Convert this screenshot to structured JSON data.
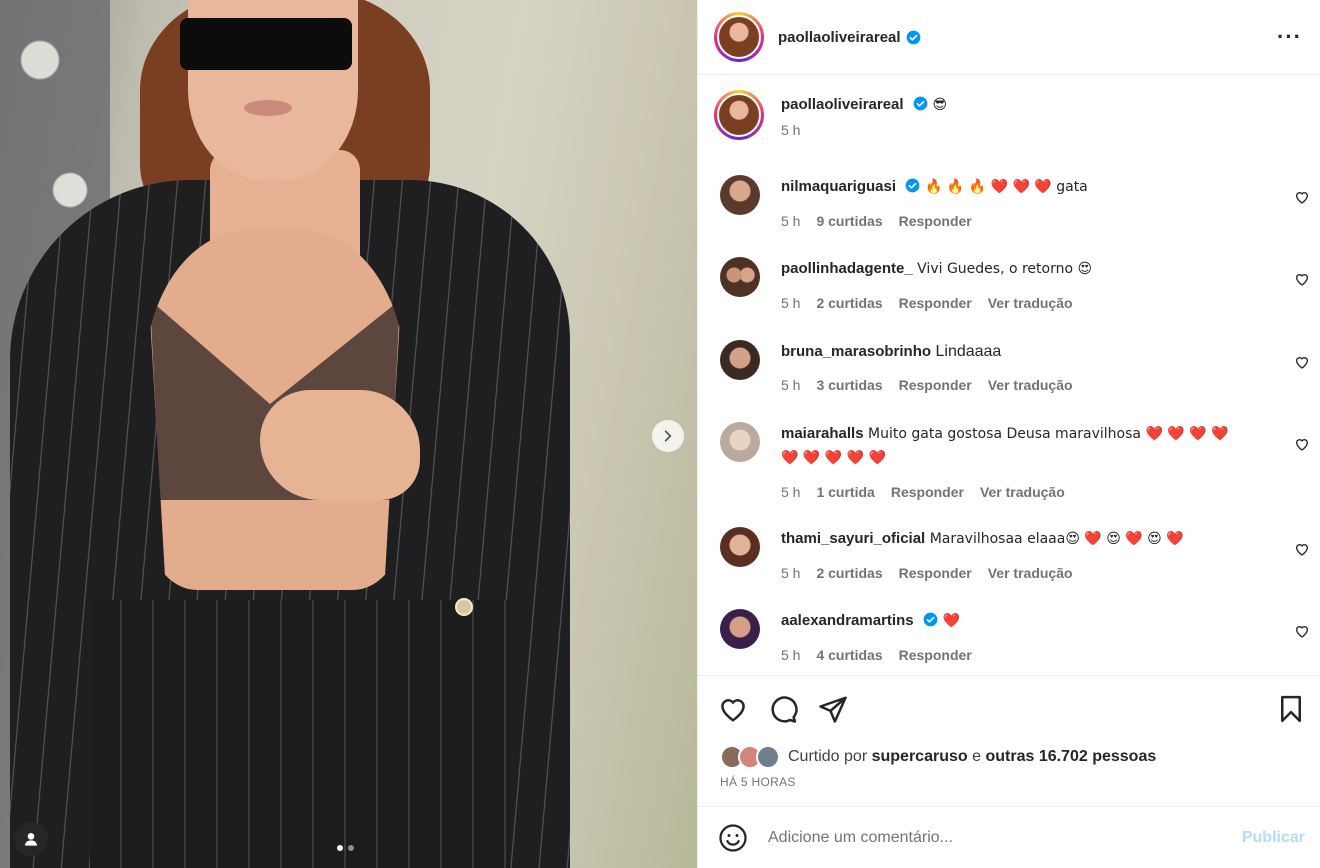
{
  "colors": {
    "accent": "#0095f6",
    "heart_red": "#ed1d24",
    "text_primary": "#262626",
    "text_secondary": "#737373",
    "publish_disabled": "#b3dbff"
  },
  "post": {
    "author": "paollaoliveirareal",
    "carousel": {
      "current_slide": 1,
      "total_slides": 2
    }
  },
  "caption": {
    "username": "paollaoliveirareal",
    "emoji": "😎",
    "time": "5 h"
  },
  "comments": [
    {
      "username": "nilmaquariguasi",
      "verified": true,
      "text": "🔥 🔥 🔥 ❤️ ❤️ ❤️ gata",
      "time": "5 h",
      "likes": "9 curtidas",
      "reply": "Responder",
      "translate": ""
    },
    {
      "username": "paollinhadagente_",
      "verified": false,
      "text": "Vivi Guedes, o retorno 😍",
      "time": "5 h",
      "likes": "2 curtidas",
      "reply": "Responder",
      "translate": "Ver tradução"
    },
    {
      "username": "bruna_marasobrinho",
      "verified": false,
      "text": "Lindaaaa",
      "time": "5 h",
      "likes": "3 curtidas",
      "reply": "Responder",
      "translate": "Ver tradução"
    },
    {
      "username": "maiarahalls",
      "verified": false,
      "text": "Muito gata gostosa Deusa maravilhosa ❤️ ❤️ ❤️ ❤️ ❤️ ❤️ ❤️ ❤️ ❤️",
      "time": "5 h",
      "likes": "1 curtida",
      "reply": "Responder",
      "translate": "Ver tradução"
    },
    {
      "username": "thami_sayuri_oficial",
      "verified": false,
      "text": "Maravilhosaa elaaa😍 ❤️ 😍 ❤️ 😍 ❤️",
      "time": "5 h",
      "likes": "2 curtidas",
      "reply": "Responder",
      "translate": "Ver tradução"
    },
    {
      "username": "aalexandramartins",
      "verified": true,
      "text": "❤️",
      "time": "5 h",
      "likes": "4 curtidas",
      "reply": "Responder",
      "translate": ""
    }
  ],
  "likes": {
    "prefix": "Curtido por",
    "liker": "supercaruso",
    "conj": "e",
    "others": "outras 16.702 pessoas"
  },
  "timestamp": "HÁ 5 HORAS",
  "add_comment": {
    "placeholder": "Adicione um comentário...",
    "publish": "Publicar"
  },
  "icons": [
    "more-icon",
    "verified-icon",
    "heart-icon",
    "comment-icon",
    "share-icon",
    "bookmark-icon",
    "emoji-icon",
    "chevron-right-icon",
    "user-tag-icon"
  ]
}
